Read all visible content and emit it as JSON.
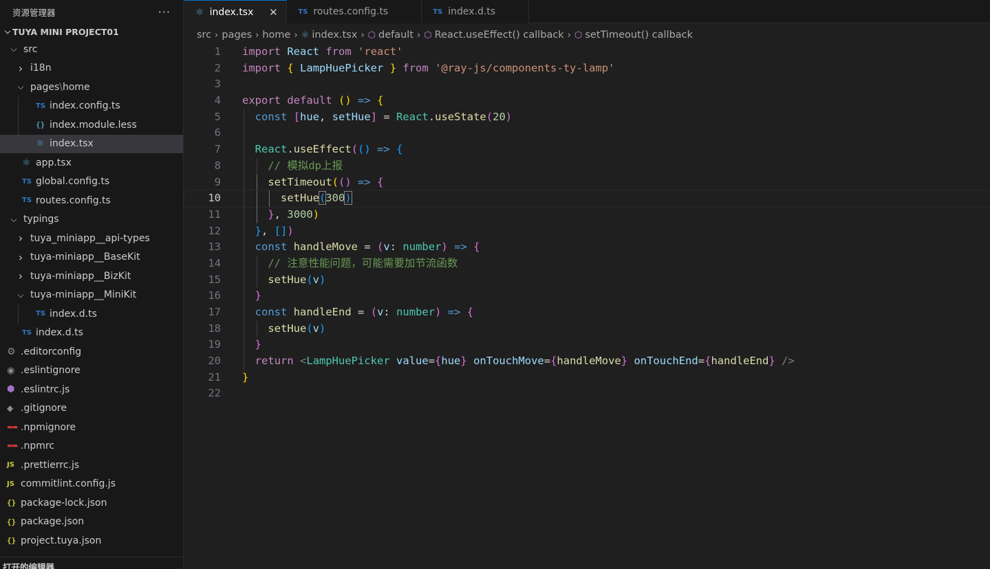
{
  "sidebar": {
    "title": "资源管理器",
    "more_label": "···",
    "project_title": "TUYA MINI PROJECT01",
    "bottom_title": "打开的编辑器",
    "tree": [
      {
        "label": "src",
        "type": "folder",
        "open": true
      },
      {
        "label": "i18n",
        "type": "folder",
        "open": false
      },
      {
        "label": "pages",
        "sub": "home",
        "type": "folder",
        "open": true
      },
      {
        "label": "index.config.ts",
        "type": "ts"
      },
      {
        "label": "index.module.less",
        "type": "less"
      },
      {
        "label": "index.tsx",
        "type": "react",
        "selected": true
      },
      {
        "label": "app.tsx",
        "type": "react"
      },
      {
        "label": "global.config.ts",
        "type": "ts"
      },
      {
        "label": "routes.config.ts",
        "type": "ts"
      },
      {
        "label": "typings",
        "type": "folder",
        "open": true
      },
      {
        "label": "tuya_miniapp__api-types",
        "type": "folder",
        "open": false
      },
      {
        "label": "tuya-miniapp__BaseKit",
        "type": "folder",
        "open": false
      },
      {
        "label": "tuya-miniapp__BizKit",
        "type": "folder",
        "open": false
      },
      {
        "label": "tuya-miniapp__MiniKit",
        "type": "folder",
        "open": true
      },
      {
        "label": "index.d.ts",
        "type": "ts"
      },
      {
        "label": "index.d.ts",
        "type": "ts"
      },
      {
        "label": ".editorconfig",
        "type": "gear"
      },
      {
        "label": ".eslintignore",
        "type": "eslint"
      },
      {
        "label": ".eslintrc.js",
        "type": "eslintrc"
      },
      {
        "label": ".gitignore",
        "type": "git"
      },
      {
        "label": ".npmignore",
        "type": "npm"
      },
      {
        "label": ".npmrc",
        "type": "npm"
      },
      {
        "label": ".prettierrc.js",
        "type": "js"
      },
      {
        "label": "commitlint.config.js",
        "type": "js"
      },
      {
        "label": "package-lock.json",
        "type": "json"
      },
      {
        "label": "package.json",
        "type": "json"
      },
      {
        "label": "project.tuya.json",
        "type": "json"
      }
    ]
  },
  "tabs": [
    {
      "label": "index.tsx",
      "icon": "react-icon",
      "active": true,
      "close": "✕"
    },
    {
      "label": "routes.config.ts",
      "icon": "ts-icon",
      "active": false
    },
    {
      "label": "index.d.ts",
      "icon": "ts-icon",
      "active": false
    }
  ],
  "breadcrumb": [
    "src",
    "pages",
    "home",
    "index.tsx",
    "default",
    "React.useEffect() callback",
    "setTimeout() callback"
  ],
  "icons": {
    "ts": "TS",
    "js": "JS",
    "json": "{}",
    "less": "{}"
  },
  "code": {
    "line_numbers": [
      "1",
      "2",
      "3",
      "4",
      "5",
      "6",
      "7",
      "8",
      "9",
      "10",
      "11",
      "12",
      "13",
      "14",
      "15",
      "16",
      "17",
      "18",
      "19",
      "20",
      "21",
      "22"
    ],
    "current_line": 10,
    "comment1": "// 模拟dp上报",
    "comment2": "// 注意性能问题，可能需要加节流函数",
    "import1_mod": "'react'",
    "import2_mod": "'@ray-js/components-ty-lamp'",
    "init_hue": "20",
    "set_value": "300",
    "delay": "3000"
  },
  "colors": {
    "accent": "#0078d4",
    "sidebar_bg": "#181818",
    "editor_bg": "#1f1f1f",
    "selected_row": "#37373d"
  }
}
